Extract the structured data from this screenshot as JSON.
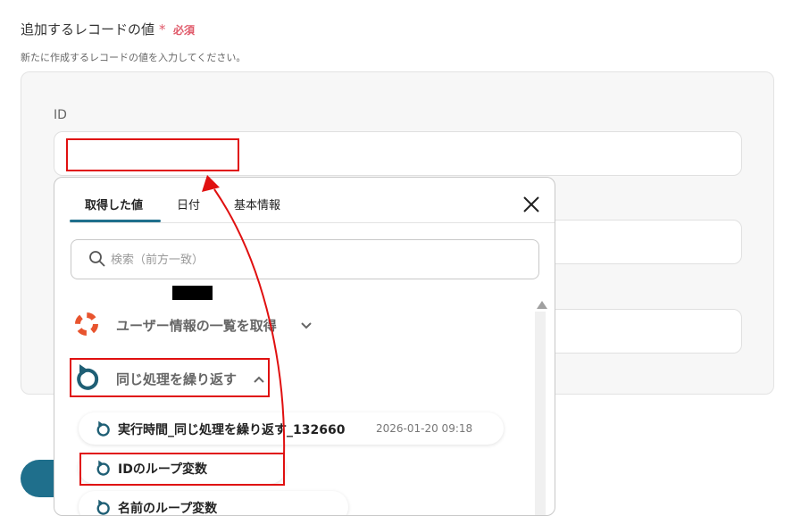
{
  "section": {
    "title": "追加するレコードの値",
    "required_star": "*",
    "required_text": "必須",
    "description": "新たに作成するレコードの値を入力してください。"
  },
  "fields": [
    {
      "label": "ID",
      "value": ""
    }
  ],
  "popup": {
    "tabs": [
      {
        "label": "取得した値",
        "active": true
      },
      {
        "label": "日付",
        "active": false
      },
      {
        "label": "基本情報",
        "active": false
      }
    ],
    "search_placeholder": "検索（前方一致）",
    "groups": [
      {
        "label": "ユーザー情報の一覧を取得",
        "icon": "lifebuoy-icon",
        "expanded": false
      },
      {
        "label": "同じ処理を繰り返す",
        "icon": "loop-icon",
        "expanded": true
      }
    ],
    "items": [
      {
        "label": "実行時間_同じ処理を繰り返す_132660",
        "meta": "2026-01-20 09:18"
      },
      {
        "label": "IDのループ変数",
        "meta": ""
      },
      {
        "label": "名前のループ変数",
        "meta": ""
      }
    ]
  },
  "colors": {
    "accent": "#1f6f8c",
    "required": "#e05a6a",
    "annotation": "#e01010",
    "lifebuoy": "#e8542e"
  }
}
